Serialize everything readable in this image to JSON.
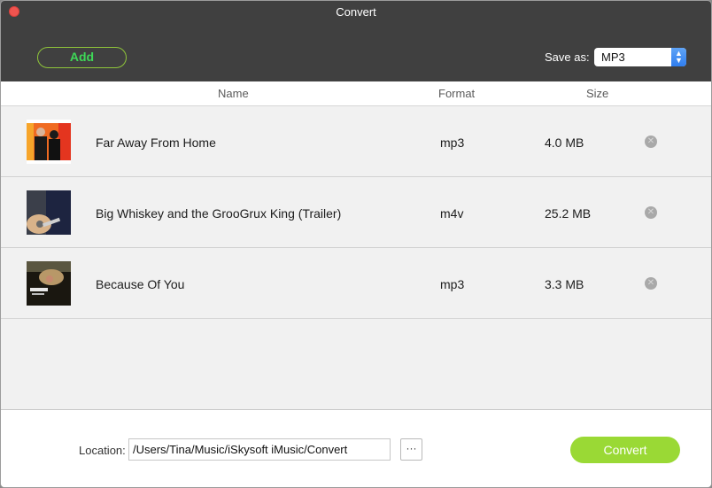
{
  "window": {
    "title": "Convert"
  },
  "toolbar": {
    "add_label": "Add",
    "save_as_label": "Save as:",
    "save_as_value": "MP3",
    "accent_color": "#3ed857"
  },
  "table": {
    "columns": [
      "Name",
      "Format",
      "Size"
    ],
    "rows": [
      {
        "name": "Far Away From Home",
        "format": "mp3",
        "size": "4.0 MB",
        "thumb": "album-art-duo-orange"
      },
      {
        "name": "Big Whiskey and the GrooGrux King (Trailer)",
        "format": "m4v",
        "size": "25.2 MB",
        "thumb": "video-thumb-guitar"
      },
      {
        "name": "Because Of You",
        "format": "mp3",
        "size": "3.3 MB",
        "thumb": "album-art-dark-portrait"
      }
    ]
  },
  "footer": {
    "location_label": "Location:",
    "location_value": "/Users/Tina/Music/iSkysoft iMusic/Convert",
    "browse_label": "···",
    "convert_label": "Convert",
    "convert_color": "#9ad935"
  }
}
